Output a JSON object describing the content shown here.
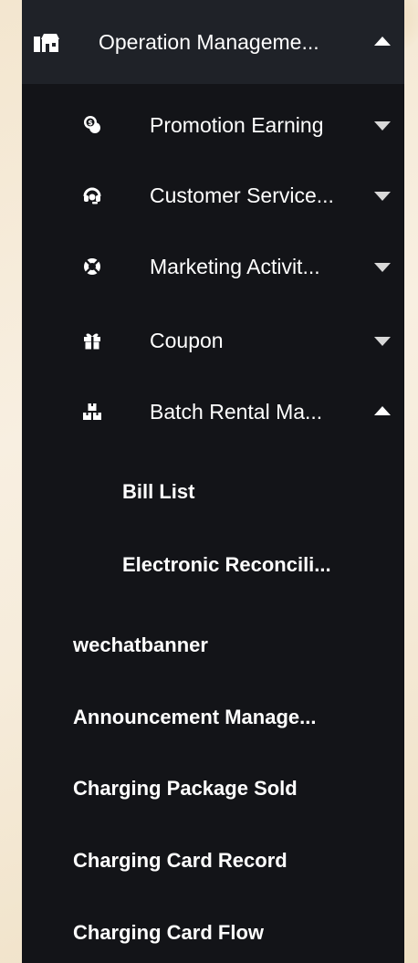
{
  "menu": {
    "title": "Operation Manageme...",
    "icon": "storefront-icon",
    "expanded": true,
    "submenus": [
      {
        "label": "Promotion Earning",
        "icon": "money-chat-icon",
        "expanded": false
      },
      {
        "label": "Customer Service...",
        "icon": "headset-icon",
        "expanded": false
      },
      {
        "label": "Marketing Activit...",
        "icon": "lifebuoy-icon",
        "expanded": false
      },
      {
        "label": "Coupon",
        "icon": "gift-icon",
        "expanded": false
      },
      {
        "label": "Batch Rental Ma...",
        "icon": "boxes-icon",
        "expanded": true
      }
    ],
    "batch_children": [
      {
        "label": "Bill List"
      },
      {
        "label": "Electronic Reconcili..."
      }
    ],
    "items": [
      {
        "label": "wechatbanner"
      },
      {
        "label": "Announcement Manage..."
      },
      {
        "label": "Charging Package Sold"
      },
      {
        "label": "Charging Card Record"
      },
      {
        "label": "Charging Card Flow"
      }
    ]
  },
  "colors": {
    "sidebar_bg": "#131418",
    "header_bg": "#1f2228",
    "text": "#ffffff",
    "page_bg": "#f6ecdb"
  }
}
